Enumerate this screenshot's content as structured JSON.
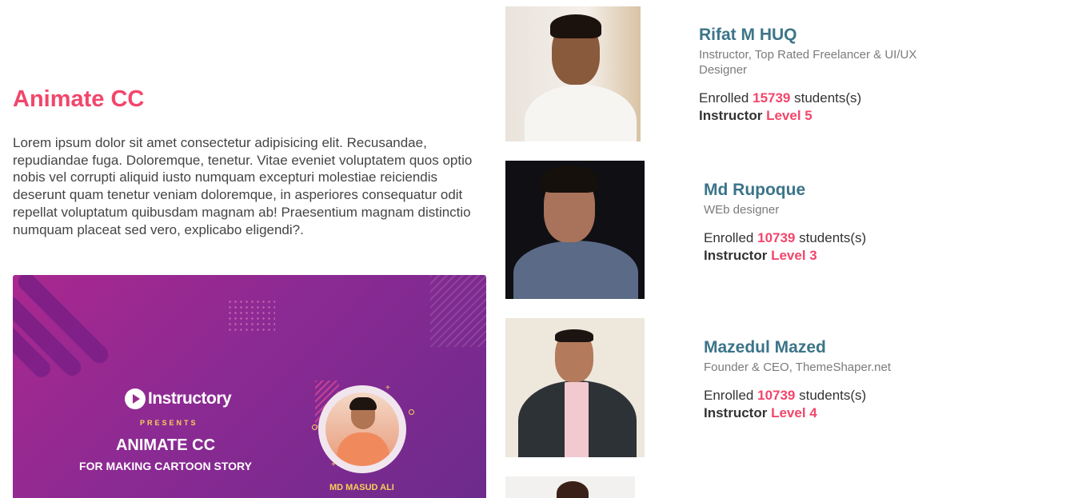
{
  "course": {
    "title": "Animate CC",
    "description": "Lorem ipsum dolor sit amet consectetur adipisicing elit. Recusandae, repudiandae fuga. Doloremque, tenetur. Vitae eveniet voluptatem quos optio nobis vel corrupti aliquid iusto numquam excepturi molestiae reiciendis deserunt quam tenetur veniam doloremque, in asperiores consequatur odit repellat voluptatum quibusdam magnam ab! Praesentium magnam distinctio numquam placeat sed vero, explicabo eligendi?."
  },
  "banner": {
    "logo": "Instructory",
    "presents": "PRESENTS",
    "title": "ANIMATE CC",
    "subtitle": "FOR MAKING CARTOON STORY",
    "presenter": "MD MASUD ALI",
    "colors": {
      "gradient_start": "#a9288f",
      "gradient_end": "#6d2b8c",
      "accent": "#f7d155"
    }
  },
  "instructors": [
    {
      "name": "Rifat M HUQ",
      "role": "Instructor, Top Rated Freelancer & UI/UX Designer",
      "enrolled_prefix": "Enrolled",
      "students": "15739",
      "students_suffix": "students(s)",
      "level_prefix": "Instructor",
      "level": "Level 5"
    },
    {
      "name": "Md Rupoque",
      "role": "WEb designer",
      "enrolled_prefix": "Enrolled",
      "students": "10739",
      "students_suffix": "students(s)",
      "level_prefix": "Instructor",
      "level": "Level 3"
    },
    {
      "name": "Mazedul Mazed",
      "role": "Founder & CEO, ThemeShaper.net",
      "enrolled_prefix": "Enrolled",
      "students": "10739",
      "students_suffix": "students(s)",
      "level_prefix": "Instructor",
      "level": "Level 4"
    }
  ],
  "colors": {
    "accent": "#f2466b",
    "name": "#3b7489"
  }
}
